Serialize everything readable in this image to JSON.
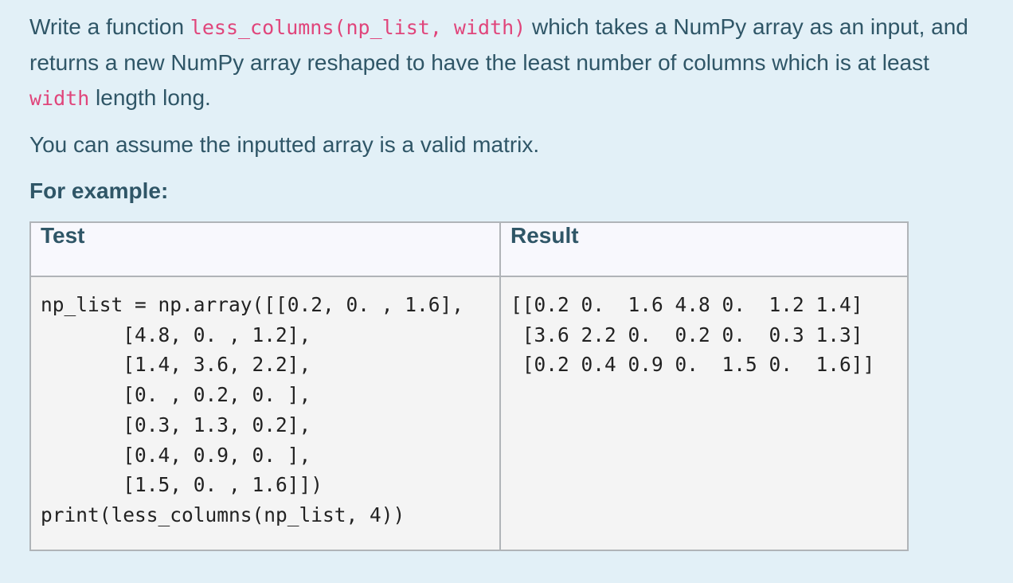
{
  "question": {
    "intro_1": "Write a function ",
    "function_signature": "less_columns(np_list, width)",
    "intro_2": " which takes a NumPy array as an input, and returns a new NumPy array reshaped to have the least number of columns which is at least ",
    "width_param": "width",
    "intro_3": " length long.",
    "assumption": "You can assume the inputted array is a valid matrix.",
    "example_heading": "For example:"
  },
  "examples_table": {
    "headers": {
      "test": "Test",
      "result": "Result"
    },
    "rows": [
      {
        "test": "np_list = np.array([[0.2, 0. , 1.6],\n       [4.8, 0. , 1.2],\n       [1.4, 3.6, 2.2],\n       [0. , 0.2, 0. ],\n       [0.3, 1.3, 0.2],\n       [0.4, 0.9, 0. ],\n       [1.5, 0. , 1.6]])\nprint(less_columns(np_list, 4))",
        "result": "[[0.2 0.  1.6 4.8 0.  1.2 1.4]\n [3.6 2.2 0.  0.2 0.  0.3 1.3]\n [0.2 0.4 0.9 0.  1.5 0.  1.6]]"
      }
    ]
  }
}
